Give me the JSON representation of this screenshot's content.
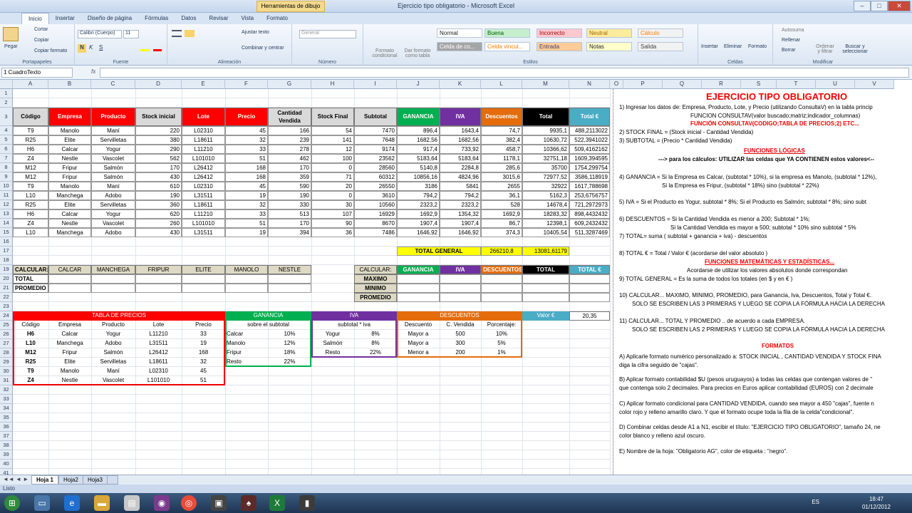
{
  "window": {
    "title": "Ejercicio tipo obligatorio - Microsoft Excel",
    "context_tab": "Herramientas de dibujo",
    "min": "–",
    "max": "□",
    "close": "✕"
  },
  "ribbon_tabs": [
    "Inicio",
    "Insertar",
    "Diseño de página",
    "Fórmulas",
    "Datos",
    "Revisar",
    "Vista",
    "Formato"
  ],
  "ribbon": {
    "paste": "Pegar",
    "cut": "Cortar",
    "copy": "Copiar",
    "format_painter": "Copiar formato",
    "clipboard": "Portapapeles",
    "font_name": "Calibri (Cuerpo)",
    "font_size": "11",
    "font": "Fuente",
    "wrap": "Ajustar texto",
    "merge": "Combinar y centrar",
    "alignment": "Alineación",
    "number_format": "General",
    "number": "Número",
    "cond_format": "Formato condicional",
    "format_table": "Dar formato como tabla",
    "cell_styles": "Celda de co...",
    "styles": "Estilos",
    "style_names": [
      "Normal",
      "Buena",
      "Incorrecto",
      "Neutral",
      "Cálculo",
      "Celda de co...",
      "Celda vincul...",
      "Entrada",
      "Notas",
      "Salida"
    ],
    "insert": "Insertar",
    "delete": "Eliminar",
    "format": "Formato",
    "cells": "Celdas",
    "autosum": "Autosuma",
    "fill": "Rellenar",
    "clear": "Borrar",
    "sort": "Ordenar y filtrar",
    "find": "Buscar y seleccionar",
    "modify": "Modificar"
  },
  "formula_bar": {
    "name_box": "1 CuadroTexto",
    "fx": "fx",
    "value": ""
  },
  "columns": [
    "A",
    "B",
    "C",
    "D",
    "E",
    "F",
    "G",
    "H",
    "I",
    "J",
    "K",
    "L",
    "M",
    "N",
    "O",
    "P",
    "Q",
    "R",
    "S",
    "T",
    "U",
    "V"
  ],
  "rows": [
    "1",
    "2",
    "3",
    "4",
    "5",
    "6",
    "7",
    "8",
    "9",
    "10",
    "11",
    "12",
    "13",
    "14",
    "15",
    "16",
    "17",
    "18",
    "19",
    "20",
    "21",
    "22",
    "23",
    "24",
    "25",
    "26",
    "27",
    "28",
    "29",
    "30",
    "31",
    "32",
    "33",
    "34",
    "35",
    "36",
    "37",
    "38",
    "39",
    "40",
    "41"
  ],
  "table_headers": [
    "Código",
    "Empresa",
    "Producto",
    "Stock inicial",
    "Lote",
    "Precio",
    "Cantidad Vendida",
    "Stock Final",
    "Subtotal",
    "GANANCIA",
    "IVA",
    "Descuentos",
    "Total",
    "Total €"
  ],
  "table_rows": [
    [
      "T9",
      "Manolo",
      "Maní",
      "220",
      "L02310",
      "45",
      "166",
      "54",
      "7470",
      "896,4",
      "1643,4",
      "74,7",
      "9935,1",
      "488,2113022"
    ],
    [
      "R25",
      "Elite",
      "Servilletas",
      "380",
      "L18611",
      "32",
      "239",
      "141",
      "7648",
      "1682,56",
      "1682,56",
      "382,4",
      "10630,72",
      "522,3941022"
    ],
    [
      "H6",
      "Calcar",
      "Yogur",
      "290",
      "L11210",
      "33",
      "278",
      "12",
      "9174",
      "917,4",
      "733,92",
      "458,7",
      "10366,62",
      "509,4162162"
    ],
    [
      "Z4",
      "Nestle",
      "Vascolet",
      "562",
      "L101010",
      "51",
      "462",
      "100",
      "23562",
      "5183,64",
      "5183,64",
      "1178,1",
      "32751,18",
      "1609,394595"
    ],
    [
      "M12",
      "Fripur",
      "Salmón",
      "170",
      "L26412",
      "168",
      "170",
      "0",
      "28560",
      "5140,8",
      "2284,8",
      "285,6",
      "35700",
      "1754,299754"
    ],
    [
      "M12",
      "Fripur",
      "Salmón",
      "430",
      "L26412",
      "168",
      "359",
      "71",
      "60312",
      "10856,16",
      "4824,96",
      "3015,6",
      "72977,52",
      "3586,118919"
    ],
    [
      "T9",
      "Manolo",
      "Maní",
      "610",
      "L02310",
      "45",
      "590",
      "20",
      "26550",
      "3186",
      "5841",
      "2655",
      "32922",
      "1617,788698"
    ],
    [
      "L10",
      "Manchega",
      "Adobo",
      "190",
      "L31511",
      "19",
      "190",
      "0",
      "3610",
      "794,2",
      "794,2",
      "36,1",
      "5162,3",
      "253,6756757"
    ],
    [
      "R25",
      "Elite",
      "Servilletas",
      "360",
      "L18611",
      "32",
      "330",
      "30",
      "10560",
      "2323,2",
      "2323,2",
      "528",
      "14678,4",
      "721,2972973"
    ],
    [
      "H6",
      "Calcar",
      "Yogur",
      "620",
      "L11210",
      "33",
      "513",
      "107",
      "16929",
      "1692,9",
      "1354,32",
      "1692,9",
      "18283,32",
      "898,4432432"
    ],
    [
      "Z4",
      "Nestle",
      "Vascolet",
      "260",
      "L101010",
      "51",
      "170",
      "90",
      "8670",
      "1907,4",
      "1907,4",
      "86,7",
      "12398,1",
      "609,2432432"
    ],
    [
      "L10",
      "Manchega",
      "Adobo",
      "430",
      "L31511",
      "19",
      "394",
      "36",
      "7486",
      "1646,92",
      "1646,92",
      "374,3",
      "10405,54",
      "511,3287469"
    ]
  ],
  "total_general": {
    "label": "TOTAL GENERAL",
    "value": "266210,8",
    "euro": "13081,61179"
  },
  "calc_block": {
    "label": "CALCULAR:",
    "cols": [
      "CALCAR",
      "MANCHEGA",
      "FRIPUR",
      "ELITE",
      "MANOLO",
      "NESTLE"
    ],
    "rows": [
      "TOTAL",
      "PROMEDIO"
    ]
  },
  "calc_block2": {
    "label": "CALCULAR:",
    "cols": [
      "GANANCIA",
      "IVA",
      "DESCUENTOS",
      "TOTAL",
      "TOTAL €"
    ],
    "rows": [
      "MAXIMO",
      "MINIMO",
      "PROMEDIO"
    ]
  },
  "precios": {
    "title": "TABLA DE PRECIOS",
    "headers": [
      "Código",
      "Empresa",
      "Producto",
      "Lote",
      "Precio"
    ],
    "rows": [
      [
        "H6",
        "Calcar",
        "Yogur",
        "L11210",
        "33"
      ],
      [
        "L10",
        "Manchega",
        "Adobo",
        "L31511",
        "19"
      ],
      [
        "M12",
        "Fripur",
        "Salmón",
        "L26412",
        "168"
      ],
      [
        "R25",
        "Elite",
        "Servilletas",
        "L18611",
        "32"
      ],
      [
        "T9",
        "Manolo",
        "Maní",
        "L02310",
        "45"
      ],
      [
        "Z4",
        "Nestle",
        "Vascolet",
        "L101010",
        "51"
      ]
    ]
  },
  "ganancia": {
    "title": "GANANCIA",
    "sub": "sobre el subtotal",
    "rows": [
      [
        "Calcar",
        "10%"
      ],
      [
        "Manolo",
        "12%"
      ],
      [
        "Fripur",
        "18%"
      ],
      [
        "Resto",
        "22%"
      ]
    ]
  },
  "iva": {
    "title": "IVA",
    "sub": "subtotal * iva",
    "rows": [
      [
        "Yogur",
        "8%"
      ],
      [
        "Salmón",
        "8%"
      ],
      [
        "Resto",
        "22%"
      ]
    ]
  },
  "descuentos": {
    "title": "DESCUENTOS",
    "headers": [
      "Descuento",
      "C. Vendida",
      "Porcentaje:"
    ],
    "rows": [
      [
        "Mayor a",
        "500",
        "10%"
      ],
      [
        "Mayor a",
        "300",
        "5%"
      ],
      [
        "Menor a",
        "200",
        "1%"
      ]
    ]
  },
  "valor_euro": {
    "label": "Valor €",
    "value": "20,35"
  },
  "notes": [
    {
      "t": "EJERCICIO TIPO OBLIGATORIO",
      "s": "title"
    },
    {
      "t": "1) Ingresar los datos de: Empresa, Producto, Lote, y Precio (utilizando ConsultaV) en la tabla princip",
      "s": "n"
    },
    {
      "t": "FUNCION CONSULTAV(valor buscado;matriz;indicador_columnas)",
      "s": "n",
      "indent": 100
    },
    {
      "t": "FUNCIÓN CONSULTAV(CODIGO;TABLA DE PRECIOS;2) ETC...",
      "s": "red",
      "indent": 100
    },
    {
      "t": "2) STOCK FINAL = (Stock inicial - Cantidad Vendida)",
      "s": "n"
    },
    {
      "t": "3) SUBTOTAL = (Precio *  Cantidad Vendida)",
      "s": "n"
    },
    {
      "t": "FUNCIONES LÓGICAS",
      "s": "redu",
      "indent": 175
    },
    {
      "t": "---> para los cálculos: UTILIZAR las celdas que YA CONTIENEN estos valores<--",
      "s": "b",
      "indent": 55
    },
    {
      "t": "4) GANANCIA = Si la Empresa es Calcar, (subtotal * 10%), si la empresa es Manolo, (subtotal * 12%),",
      "s": "n"
    },
    {
      "t": "Si la Empresa es Fripur, (subtotal  * 18%) sino (subtotal * 22%)",
      "s": "n",
      "indent": 60
    },
    {
      "t": "5) IVA = Si  el Producto es Yogur,  subtotal * 8%; Si el Producto es Salmón;  subtotal * 8%; sino subt",
      "s": "n"
    },
    {
      "t": "6) DESCUENTOS = Si la Cantidad Vendida es menor a  200; Subtotal * 1%;",
      "s": "n"
    },
    {
      "t": "Si la Cantidad Vendida es mayor a 500; subtotal * 10% sino subtotal * 5%",
      "s": "n",
      "indent": 72
    },
    {
      "t": "7) TOTAL= suma ( subtotal + ganancia + iva) - descuentos",
      "s": "n"
    },
    {
      "t": "8) TOTAL € = Total / Valor € (acordarse del valor absoluto )",
      "s": "n"
    },
    {
      "t": "FUNCIONES MATEMÁTICAS Y ESTADÍSTICAS...",
      "s": "redu",
      "indent": 120
    },
    {
      "t": "Acordarse de utilizar los valores absolutos donde correspondan",
      "s": "n",
      "indent": 95
    },
    {
      "t": "9) TOTAL GENERAL = Es la suma de todos los totales (en $ y en € )",
      "s": "n"
    },
    {
      "t": "10) CALCULAR... MAXIMO, MINIMO, PROMEDIO, para Ganancia, Iva, Descuentos, Total y Total €.",
      "s": "n"
    },
    {
      "t": "SOLO SE ESCRIBEN LAS 3 PRIMERAS Y LUEGO SE COPIA LA FÓRMULA HACIA LA DERECHA",
      "s": "n",
      "indent": 18
    },
    {
      "t": "11) CALCULAR... TOTAL Y PROMEDIO .. de acuerdo a cada EMPRESA.",
      "s": "n"
    },
    {
      "t": "SOLO SE ESCRIBEN LAS 2 PRIMERAS Y LUEGO SE COPIA LA FÓRMULA HACIA LA DERECHA",
      "s": "n",
      "indent": 18
    },
    {
      "t": "FORMATOS",
      "s": "red",
      "indent": 200
    },
    {
      "t": "A) Aplicarle formato numérico personalizado a: STOCK INICIAL , CANTIDAD VENDIDA Y STOCK FINA",
      "s": "n"
    },
    {
      "t": "diga la cifra seguido de \"cajas\".",
      "s": "n"
    },
    {
      "t": "B) Aplicar formato contabilidad $U  (pesos uruguayos) a todas las celdas que contengan valores de \"",
      "s": "n"
    },
    {
      "t": "que contenga solo 2 decimales.   Para precios en Euros aplicar contabilidad (EUROS) con 2 decimale",
      "s": "n"
    },
    {
      "t": "C) Aplicar formato condicional para CANTIDAD VENDIDA, cuando sea mayor a 450 \"cajas\", fuente n",
      "s": "n"
    },
    {
      "t": "color rojo y relleno amarillo claro.  Y que el formato ocupe toda la fila de la celda\"condicional\".",
      "s": "n"
    },
    {
      "t": "D) Combinar celdas desde A1 a N1, escibir el título: \"EJERCICIO TIPO OBLIGATORIO\",  tamaño 24, ne",
      "s": "n"
    },
    {
      "t": "color blanco  y relleno azul oscuro.",
      "s": "n"
    },
    {
      "t": "E) Nombre de la hoja: \"Obligatorio AG\", color de etiqueta : \"negro\".",
      "s": "n"
    }
  ],
  "sheets": [
    "Hoja 1",
    "Hoja2",
    "Hoja3"
  ],
  "status": "Listo",
  "tray": {
    "lang": "ES",
    "time": "18:47",
    "date": "01/12/2012"
  },
  "colors": {
    "ganancia": "#00b050",
    "iva": "#7030a0",
    "descuentos": "#e46c0a",
    "total": "#000000",
    "total_euro": "#4bacc6",
    "red": "#ff0000",
    "header": "#d9d9d9",
    "yellow": "#ffff00"
  }
}
